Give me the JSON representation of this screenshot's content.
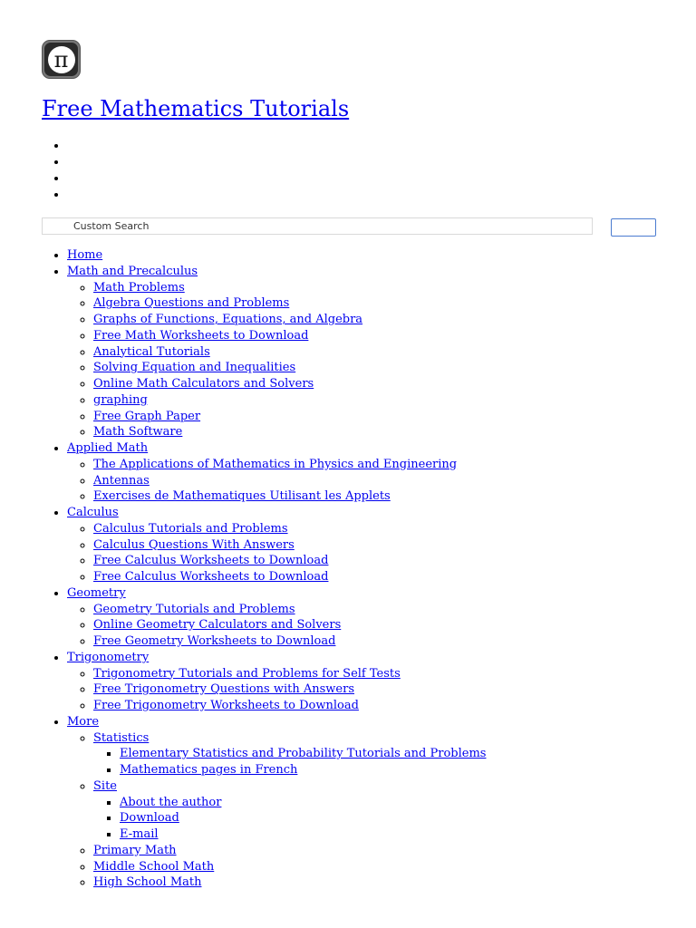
{
  "site": {
    "logo_icon": "pi-icon",
    "logo_glyph": "π",
    "title": "Free Mathematics Tutorials"
  },
  "search": {
    "placeholder": "Custom Search"
  },
  "nav": {
    "home": "Home",
    "math_precalc": {
      "label": "Math and Precalculus",
      "items": [
        "Math Problems",
        "Algebra Questions and Problems",
        "Graphs of Functions, Equations, and Algebra",
        "Free Math Worksheets to Download",
        "Analytical Tutorials",
        "Solving Equation and Inequalities",
        "Online Math Calculators and Solvers",
        "graphing",
        "Free Graph Paper",
        "Math Software"
      ]
    },
    "applied": {
      "label": "Applied Math",
      "items": [
        "The Applications of Mathematics in Physics and Engineering",
        "Antennas",
        "Exercises de Mathematiques Utilisant les Applets"
      ]
    },
    "calculus": {
      "label": "Calculus",
      "items": [
        "Calculus Tutorials and Problems",
        "Calculus Questions With Answers",
        "Free Calculus Worksheets to Download",
        "Free Calculus Worksheets to Download"
      ]
    },
    "geometry": {
      "label": "Geometry",
      "items": [
        "Geometry Tutorials and Problems",
        "Online Geometry Calculators and Solvers",
        "Free Geometry Worksheets to Download"
      ]
    },
    "trig": {
      "label": "Trigonometry",
      "items": [
        "Trigonometry Tutorials and Problems for Self Tests",
        "Free Trigonometry Questions with Answers",
        "Free Trigonometry Worksheets to Download"
      ]
    },
    "more": {
      "label": "More",
      "statistics": {
        "label": "Statistics",
        "items": [
          "Elementary Statistics and Probability Tutorials and Problems",
          "Mathematics pages in French"
        ]
      },
      "site": {
        "label": "Site",
        "items": [
          "About the author",
          "Download",
          "E-mail"
        ]
      },
      "items": [
        "Primary Math",
        "Middle School Math",
        "High School Math"
      ]
    }
  }
}
